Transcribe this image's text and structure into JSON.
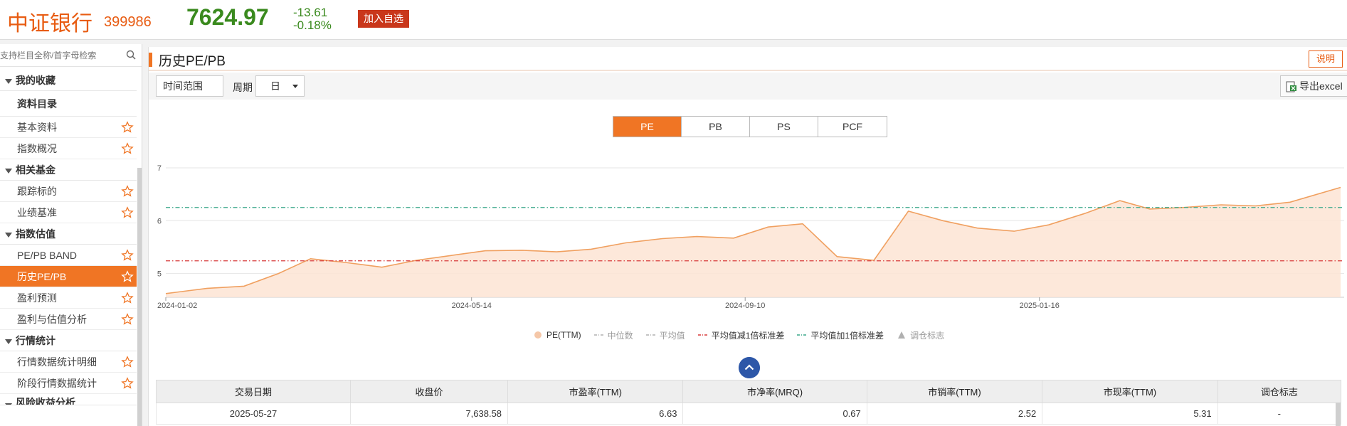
{
  "header": {
    "index_name": "中证银行",
    "index_code": "399986",
    "price": "7624.97",
    "change": "-13.61",
    "change_pct": "-0.18%",
    "watch_button": "加入自选",
    "price_color": "#3a8a1e",
    "accent_color": "#e85c12"
  },
  "sidebar": {
    "search_placeholder": "支持栏目全称/首字母检索",
    "search_icon": "search-icon",
    "favorites": "我的收藏",
    "catalog_title": "资料目录",
    "items": [
      {
        "type": "leaf",
        "label": "基本资料"
      },
      {
        "type": "leaf",
        "label": "指数概况"
      },
      {
        "type": "group",
        "label": "相关基金"
      },
      {
        "type": "leaf",
        "label": "跟踪标的"
      },
      {
        "type": "leaf",
        "label": "业绩基准"
      },
      {
        "type": "group",
        "label": "指数估值"
      },
      {
        "type": "leaf",
        "label": "PE/PB BAND"
      },
      {
        "type": "leaf",
        "label": "历史PE/PB",
        "active": true
      },
      {
        "type": "leaf",
        "label": "盈利预测"
      },
      {
        "type": "leaf",
        "label": "盈利与估值分析"
      },
      {
        "type": "group",
        "label": "行情统计"
      },
      {
        "type": "leaf",
        "label": "行情数据统计明细"
      },
      {
        "type": "leaf",
        "label": "阶段行情数据统计"
      },
      {
        "type": "group",
        "label": "风险收益分析"
      }
    ],
    "star_icon": "star-icon",
    "active_color": "#f07524"
  },
  "panel": {
    "title": "历史PE/PB",
    "help_button": "说明",
    "range_label": "时间范围",
    "period_label": "周期",
    "period_value": "日",
    "export_label": "导出excel"
  },
  "metric_tabs": [
    {
      "label": "PE",
      "active": true
    },
    {
      "label": "PB",
      "active": false
    },
    {
      "label": "PS",
      "active": false
    },
    {
      "label": "PCF",
      "active": false
    }
  ],
  "chart_data": {
    "type": "area",
    "x_ticks": [
      "2024-01-02",
      "2024-05-14",
      "2024-09-10",
      "2025-01-16"
    ],
    "y_ticks": [
      5,
      6,
      7
    ],
    "ylim": [
      4.55,
      7.0
    ],
    "series": [
      {
        "name": "PE(TTM)",
        "x": [
          "2024-01-02",
          "2024-01-20",
          "2024-02-05",
          "2024-02-20",
          "2024-03-05",
          "2024-03-20",
          "2024-04-05",
          "2024-04-20",
          "2024-05-05",
          "2024-05-20",
          "2024-06-05",
          "2024-06-20",
          "2024-07-05",
          "2024-07-20",
          "2024-08-05",
          "2024-08-20",
          "2024-09-05",
          "2024-09-20",
          "2024-10-05",
          "2024-10-20",
          "2024-11-05",
          "2024-11-20",
          "2024-12-05",
          "2024-12-20",
          "2025-01-05",
          "2025-01-20",
          "2025-02-05",
          "2025-02-20",
          "2025-03-05",
          "2025-03-20",
          "2025-04-05",
          "2025-04-20",
          "2025-05-05",
          "2025-05-27"
        ],
        "values": [
          4.62,
          4.72,
          4.76,
          5.0,
          5.28,
          5.21,
          5.12,
          5.25,
          5.34,
          5.43,
          5.44,
          5.41,
          5.46,
          5.58,
          5.66,
          5.7,
          5.67,
          5.88,
          5.94,
          5.32,
          5.25,
          6.18,
          6.0,
          5.86,
          5.8,
          5.92,
          6.14,
          6.38,
          6.22,
          6.25,
          6.3,
          6.28,
          6.35,
          6.63
        ]
      }
    ],
    "reference_lines": [
      {
        "name": "平均值加1倍标准差",
        "value": 6.25,
        "color": "#3aa88a"
      },
      {
        "name": "平均值减1倍标准差",
        "value": 5.24,
        "color": "#d83a3a"
      }
    ],
    "line_color": "#f0a060",
    "fill_color": "#fde4d4"
  },
  "legend": [
    {
      "label": "PE(TTM)",
      "color": "#f5c7a8",
      "on": true,
      "shape": "dot"
    },
    {
      "label": "中位数",
      "color": "#b0b0b0",
      "on": false,
      "shape": "dash"
    },
    {
      "label": "平均值",
      "color": "#b0b0b0",
      "on": false,
      "shape": "dash"
    },
    {
      "label": "平均值减1倍标准差",
      "color": "#d83a3a",
      "on": true,
      "shape": "dash"
    },
    {
      "label": "平均值加1倍标准差",
      "color": "#3aa88a",
      "on": true,
      "shape": "dash"
    },
    {
      "label": "调仓标志",
      "color": "#b0b0b0",
      "on": false,
      "shape": "tri"
    }
  ],
  "collapse_icon": "chevron-up-icon",
  "table": {
    "headers": [
      "交易日期",
      "收盘价",
      "市盈率(TTM)",
      "市净率(MRQ)",
      "市销率(TTM)",
      "市现率(TTM)",
      "调仓标志"
    ],
    "rows": [
      [
        "2025-05-27",
        "7,638.58",
        "6.63",
        "0.67",
        "2.52",
        "5.31",
        "-"
      ]
    ]
  }
}
